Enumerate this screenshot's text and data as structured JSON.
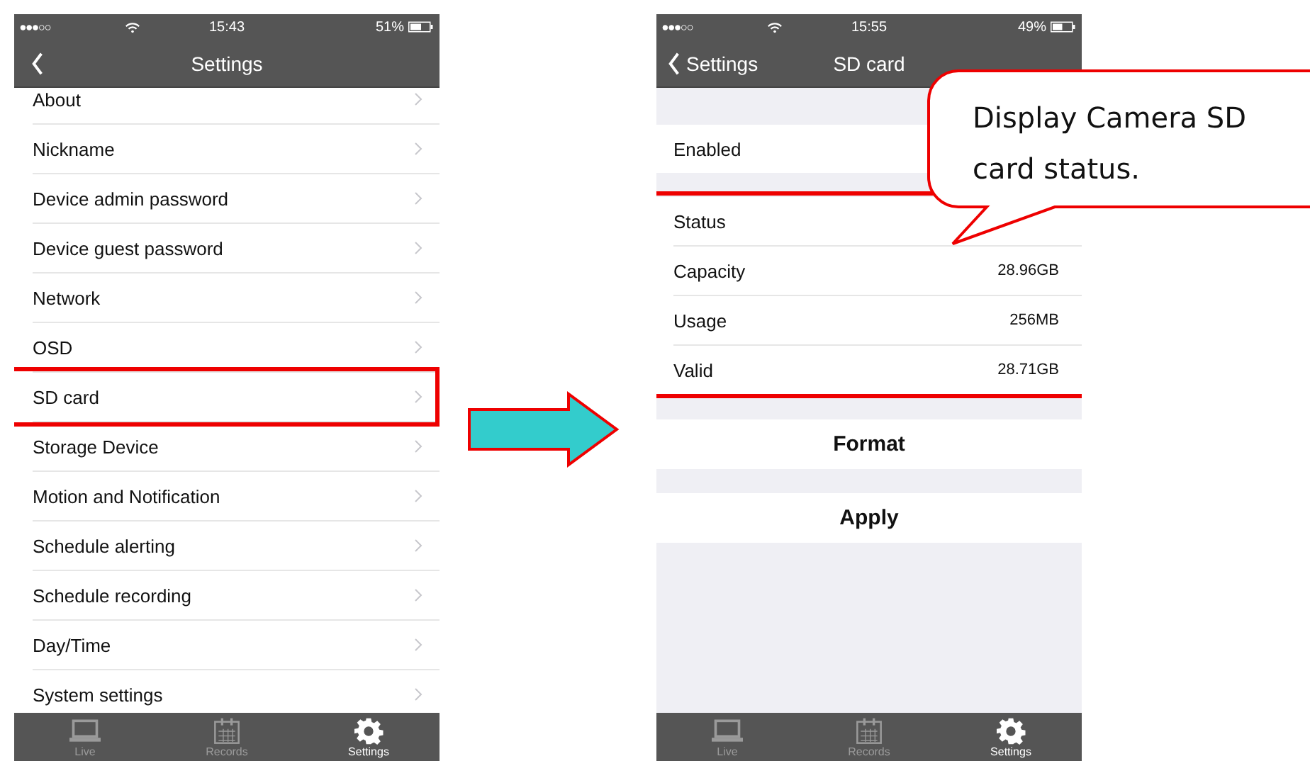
{
  "left_screen": {
    "status_bar": {
      "time": "15:43",
      "battery": "51%"
    },
    "nav": {
      "title": "Settings"
    },
    "items": [
      {
        "label": "About",
        "highlighted": false
      },
      {
        "label": "Nickname",
        "highlighted": false
      },
      {
        "label": "Device admin password",
        "highlighted": false
      },
      {
        "label": "Device guest password",
        "highlighted": false
      },
      {
        "label": "Network",
        "highlighted": false
      },
      {
        "label": "OSD",
        "highlighted": false
      },
      {
        "label": "SD card",
        "highlighted": true
      },
      {
        "label": "Storage Device",
        "highlighted": false
      },
      {
        "label": "Motion and Notification",
        "highlighted": false
      },
      {
        "label": "Schedule alerting",
        "highlighted": false
      },
      {
        "label": "Schedule recording",
        "highlighted": false
      },
      {
        "label": "Day/Time",
        "highlighted": false
      },
      {
        "label": "System settings",
        "highlighted": false
      }
    ],
    "tabs": [
      {
        "kind": "laptop",
        "label": "Live",
        "selected": false
      },
      {
        "kind": "calendar",
        "label": "Records",
        "selected": false
      },
      {
        "kind": "gear",
        "label": "Settings",
        "selected": true
      }
    ]
  },
  "right_screen": {
    "status_bar": {
      "time": "15:55",
      "battery": "49%"
    },
    "nav": {
      "back": "Settings",
      "title": "SD card"
    },
    "sections": [
      {
        "kind": "rows",
        "highlighted": false,
        "rows": [
          {
            "label": "Enabled"
          }
        ]
      },
      {
        "kind": "rows",
        "highlighted": true,
        "rows": [
          {
            "label": "Status"
          },
          {
            "label": "Capacity",
            "value": "28.96GB"
          },
          {
            "label": "Usage",
            "value": "256MB"
          },
          {
            "label": "Valid",
            "value": "28.71GB"
          }
        ]
      },
      {
        "kind": "button",
        "label": "Format"
      },
      {
        "kind": "button",
        "label": "Apply"
      }
    ],
    "tabs": [
      {
        "kind": "laptop",
        "label": "Live",
        "selected": false
      },
      {
        "kind": "calendar",
        "label": "Records",
        "selected": false
      },
      {
        "kind": "gear",
        "label": "Settings",
        "selected": true
      }
    ]
  },
  "callout": {
    "text": "Display Camera SD card status."
  }
}
